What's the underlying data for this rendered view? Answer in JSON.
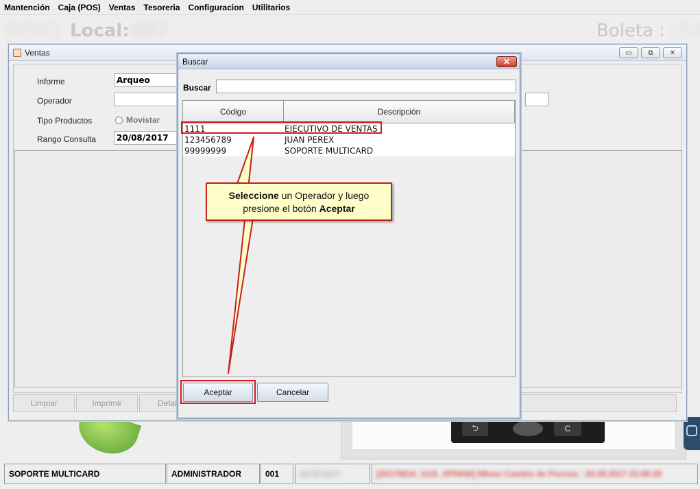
{
  "menu": [
    "Mantención",
    "Caja (POS)",
    "Ventas",
    "Tesoreria",
    "Configuracion",
    "Utilitarios"
  ],
  "banner": {
    "left_prefix_blurred": "DEMO",
    "local_label": "Local:",
    "local_value_blurred": "007",
    "boleta_label": "Boleta :",
    "boleta_value_blurred": "154"
  },
  "ventas": {
    "title": "Ventas",
    "window_buttons": {
      "minimize": "▭",
      "restore": "⧉",
      "close": "✕"
    },
    "labels": {
      "informe": "Informe",
      "operador": "Operador",
      "tipo": "Tipo Productos",
      "rango": "Rango Consulta"
    },
    "informe_value": "Arqueo",
    "radio_movistar": "Movistar",
    "fecha": "20/08/2017",
    "buttons": {
      "limpiar": "Limpiar",
      "imprimir": "Imprimir",
      "detalle": "Detal"
    }
  },
  "dialog": {
    "title": "Buscar",
    "close_glyph": "✕",
    "search_label": "Buscar",
    "search_value": "",
    "columns": [
      "Código",
      "Descripción"
    ],
    "rows": [
      {
        "codigo": "1111",
        "descripcion": "EJECUTIVO DE VENTAS"
      },
      {
        "codigo": "123456789",
        "descripcion": "JUAN PEREX"
      },
      {
        "codigo": "99999999",
        "descripcion": "SOPORTE MULTICARD"
      }
    ],
    "accept": "Aceptar",
    "cancel": "Cancelar"
  },
  "callout": {
    "bold1": "Seleccione",
    "text1": " un Operador y luego",
    "text2": "presione el botón ",
    "bold2": "Aceptar"
  },
  "device_keys": {
    "back": "⮌",
    "c": "C"
  },
  "status": {
    "user": "SOPORTE MULTICARD",
    "role": "ADMINISTRADOR",
    "code": "001",
    "date_blurred": "20.08.2017",
    "message_blurred": "[20170816_1115_XPD640] Mbms Cambio de Precios : 20.08.2017 23:06:20"
  },
  "colors": {
    "highlight": "#d11a1a",
    "callout_bg": "#fffec8"
  }
}
